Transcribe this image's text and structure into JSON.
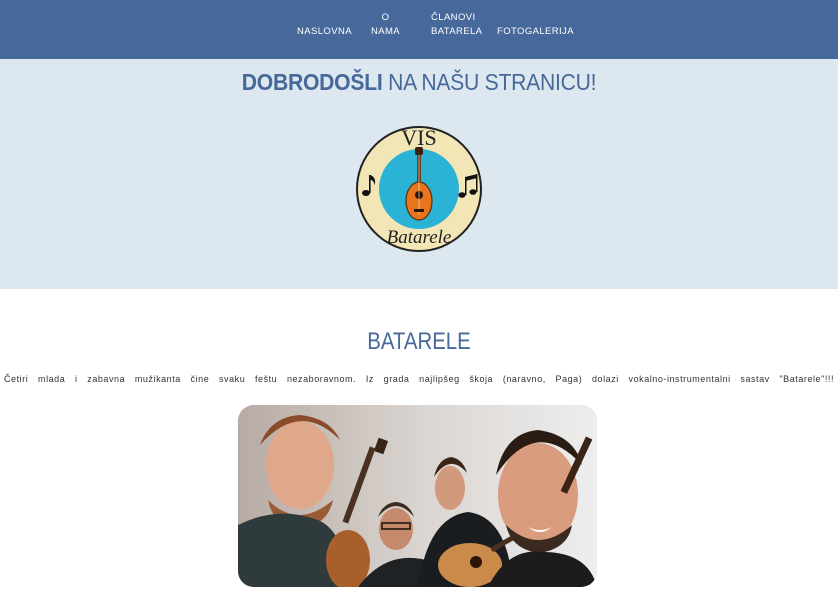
{
  "nav": {
    "items": [
      {
        "lines": [
          "NASLOVNA"
        ]
      },
      {
        "lines": [
          "O",
          "NAMA"
        ]
      },
      {
        "lines": [
          "ČLANOVI",
          "BATARELA"
        ]
      },
      {
        "lines": [
          "FOTOGALERIJA"
        ]
      }
    ]
  },
  "hero": {
    "title_bold": "DOBRODOŠLI",
    "title_rest": "NA NAŠU STRANICU!",
    "logo": {
      "top_text": "VIS",
      "bottom_text": "Batarele"
    }
  },
  "section": {
    "title": "BATARELE",
    "text": "Četiri mlada i zabavna mužikanta čine svaku feštu nezaboravnom. Iz grada najlipšeg škoja (naravno, Paga) dolazi vokalno-instrumentalni sastav \"Batarele\"!!!"
  },
  "colors": {
    "nav_bg": "#46689a",
    "hero_bg": "#dce7ef",
    "accent": "#46689a"
  }
}
